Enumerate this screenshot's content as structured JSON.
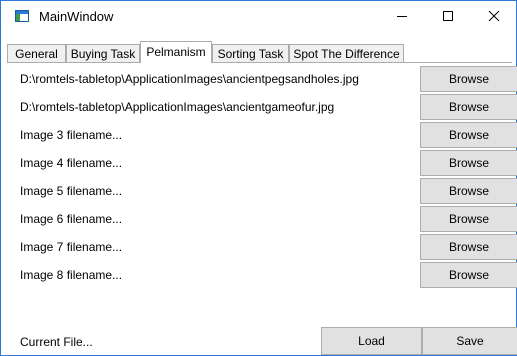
{
  "window": {
    "title": "MainWindow",
    "icon": "app-window-icon",
    "controls": [
      "minimize-icon",
      "maximize-icon",
      "close-icon"
    ]
  },
  "tabs": [
    {
      "label": "General",
      "active": false
    },
    {
      "label": "Buying Task",
      "active": false
    },
    {
      "label": "Pelmanism",
      "active": true
    },
    {
      "label": "Sorting Task",
      "active": false
    },
    {
      "label": "Spot The Difference",
      "active": false
    }
  ],
  "rows": [
    {
      "label": "D:\\romtels-tabletop\\ApplicationImages\\ancientpegsandholes.jpg",
      "button": "Browse"
    },
    {
      "label": "D:\\romtels-tabletop\\ApplicationImages\\ancientgameofur.jpg",
      "button": "Browse"
    },
    {
      "label": "Image 3 filename...",
      "button": "Browse"
    },
    {
      "label": "Image 4 filename...",
      "button": "Browse"
    },
    {
      "label": "Image 5 filename...",
      "button": "Browse"
    },
    {
      "label": "Image 6 filename...",
      "button": "Browse"
    },
    {
      "label": "Image 7 filename...",
      "button": "Browse"
    },
    {
      "label": "Image 8 filename...",
      "button": "Browse"
    }
  ],
  "footer": {
    "current_file": "Current File...",
    "load_label": "Load",
    "save_label": "Save"
  },
  "colors": {
    "window_border": "#2b79d8",
    "button_face": "#e1e1e1",
    "button_border": "#adadad",
    "tab_inactive": "#f0f0f0"
  }
}
